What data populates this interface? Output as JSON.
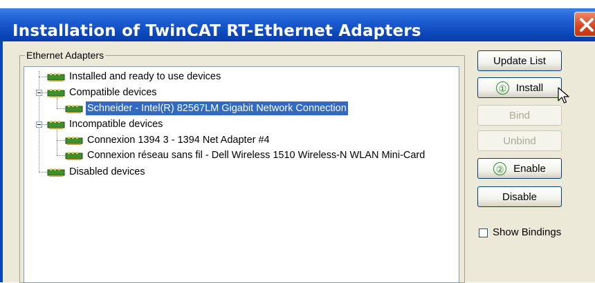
{
  "window": {
    "title": "Installation of TwinCAT RT-Ethernet Adapters"
  },
  "group": {
    "label": "Ethernet Adapters"
  },
  "tree": {
    "nodes": [
      {
        "label": "Installed and ready to use devices"
      },
      {
        "label": "Compatible devices"
      },
      {
        "label": "Schneider - Intel(R) 82567LM Gigabit Network Connection"
      },
      {
        "label": "Incompatible devices"
      },
      {
        "label": "Connexion 1394 3 - 1394 Net Adapter #4"
      },
      {
        "label": "Connexion réseau sans fil - Dell Wireless 1510 Wireless-N WLAN Mini-Card"
      },
      {
        "label": "Disabled devices"
      }
    ]
  },
  "buttons": {
    "update_list": "Update List",
    "install": "Install",
    "install_marker": "①",
    "bind": "Bind",
    "unbind": "Unbind",
    "enable": "Enable",
    "enable_marker": "②",
    "disable": "Disable"
  },
  "options": {
    "show_bindings": "Show Bindings"
  },
  "colors": {
    "titlebar": "#0b46b8",
    "selection": "#316ac5",
    "annotation_green": "#2b8a2b",
    "dialog_bg": "#ece9d8"
  },
  "icons": [
    "network-adapter-icon",
    "close-icon",
    "expander-icon",
    "mouse-cursor-icon"
  ]
}
